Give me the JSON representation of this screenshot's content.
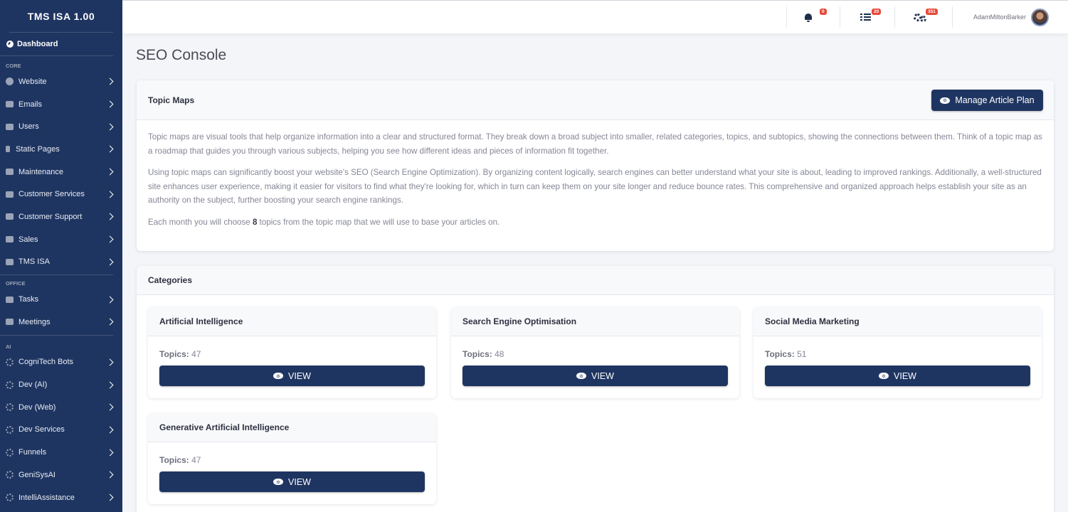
{
  "app": {
    "title": "TMS ISA 1.00"
  },
  "sidebar": {
    "dashboard": "Dashboard",
    "sections": [
      {
        "label": "CORE",
        "items": [
          {
            "label": "Website",
            "icon": "globe-icon"
          },
          {
            "label": "Emails",
            "icon": "envelope-icon"
          },
          {
            "label": "Users",
            "icon": "users-icon"
          },
          {
            "label": "Static Pages",
            "icon": "file-icon"
          },
          {
            "label": "Maintenance",
            "icon": "tools-icon"
          },
          {
            "label": "Customer Services",
            "icon": "list-icon"
          },
          {
            "label": "Customer Support",
            "icon": "list-icon"
          },
          {
            "label": "Sales",
            "icon": "list-icon"
          },
          {
            "label": "TMS ISA",
            "icon": "robot-icon"
          }
        ]
      },
      {
        "label": "OFFICE",
        "items": [
          {
            "label": "Tasks",
            "icon": "tasks-icon"
          },
          {
            "label": "Meetings",
            "icon": "calendar-icon"
          }
        ]
      },
      {
        "label": "AI",
        "items": [
          {
            "label": "CogniTech Bots",
            "icon": "gear-icon"
          },
          {
            "label": "Dev (AI)",
            "icon": "gear-icon"
          },
          {
            "label": "Dev (Web)",
            "icon": "gear-icon"
          },
          {
            "label": "Dev Services",
            "icon": "gear-icon"
          },
          {
            "label": "Funnels",
            "icon": "gear-icon"
          },
          {
            "label": "GeniSysAI",
            "icon": "gear-icon"
          },
          {
            "label": "IntelliAssistance",
            "icon": "gear-icon"
          }
        ]
      }
    ]
  },
  "topbar": {
    "notifications_count": "0",
    "tasks_count": "20",
    "settings_count": "351",
    "user_name": "AdamMiltonBarker"
  },
  "page": {
    "title": "SEO Console"
  },
  "topic_maps": {
    "title": "Topic Maps",
    "button_label": "Manage Article Plan",
    "paragraph_1": "Topic maps are visual tools that help organize information into a clear and structured format. They break down a broad subject into smaller, related categories, topics, and subtopics, showing the connections between them. Think of a topic map as a roadmap that guides you through various subjects, helping you see how different ideas and pieces of information fit together.",
    "paragraph_2": "Using topic maps can significantly boost your website's SEO (Search Engine Optimization). By organizing content logically, search engines can better understand what your site is about, leading to improved rankings. Additionally, a well-structured site enhances user experience, making it easier for visitors to find what they're looking for, which in turn can keep them on your site longer and reduce bounce rates. This comprehensive and organized approach helps establish your site as an authority on the subject, further boosting your search engine rankings.",
    "paragraph_3_prefix": "Each month you will choose ",
    "paragraph_3_count": "8",
    "paragraph_3_suffix": " topics from the topic map that we will use to base your articles on."
  },
  "categories": {
    "title": "Categories",
    "topics_label": "Topics:",
    "view_label": "VIEW",
    "items": [
      {
        "name": "Artificial Intelligence",
        "topics": "47"
      },
      {
        "name": "Search Engine Optimisation",
        "topics": "48"
      },
      {
        "name": "Social Media Marketing",
        "topics": "51"
      },
      {
        "name": "Generative Artificial Intelligence",
        "topics": "47"
      }
    ]
  }
}
